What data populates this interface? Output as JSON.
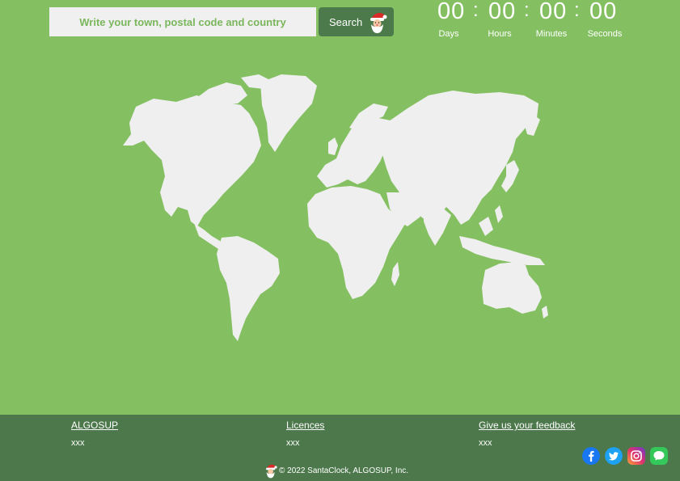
{
  "search": {
    "placeholder": "Write your town, postal code and country",
    "button_label": "Search"
  },
  "countdown": {
    "days": "00",
    "hours": "00",
    "minutes": "00",
    "seconds": "00",
    "separator": ":",
    "labels": {
      "days": "Days",
      "hours": "Hours",
      "minutes": "Minutes",
      "seconds": "Seconds"
    }
  },
  "footer": {
    "columns": [
      {
        "title": "ALGOSUP",
        "sub": "xxx"
      },
      {
        "title": "Licences",
        "sub": "xxx"
      },
      {
        "title": "Give us your feedback",
        "sub": "xxx"
      }
    ],
    "copyright": "© 2022 SantaClock, ALGOSUP, Inc.",
    "social": [
      "facebook-icon",
      "twitter-icon",
      "instagram-icon",
      "message-icon"
    ]
  },
  "colors": {
    "background": "#84c062",
    "footer": "#4c784b",
    "button": "#4c7a4b",
    "map_land": "#efefef",
    "facebook": "#1877f2",
    "twitter": "#1da1f2",
    "message": "#34c759"
  }
}
